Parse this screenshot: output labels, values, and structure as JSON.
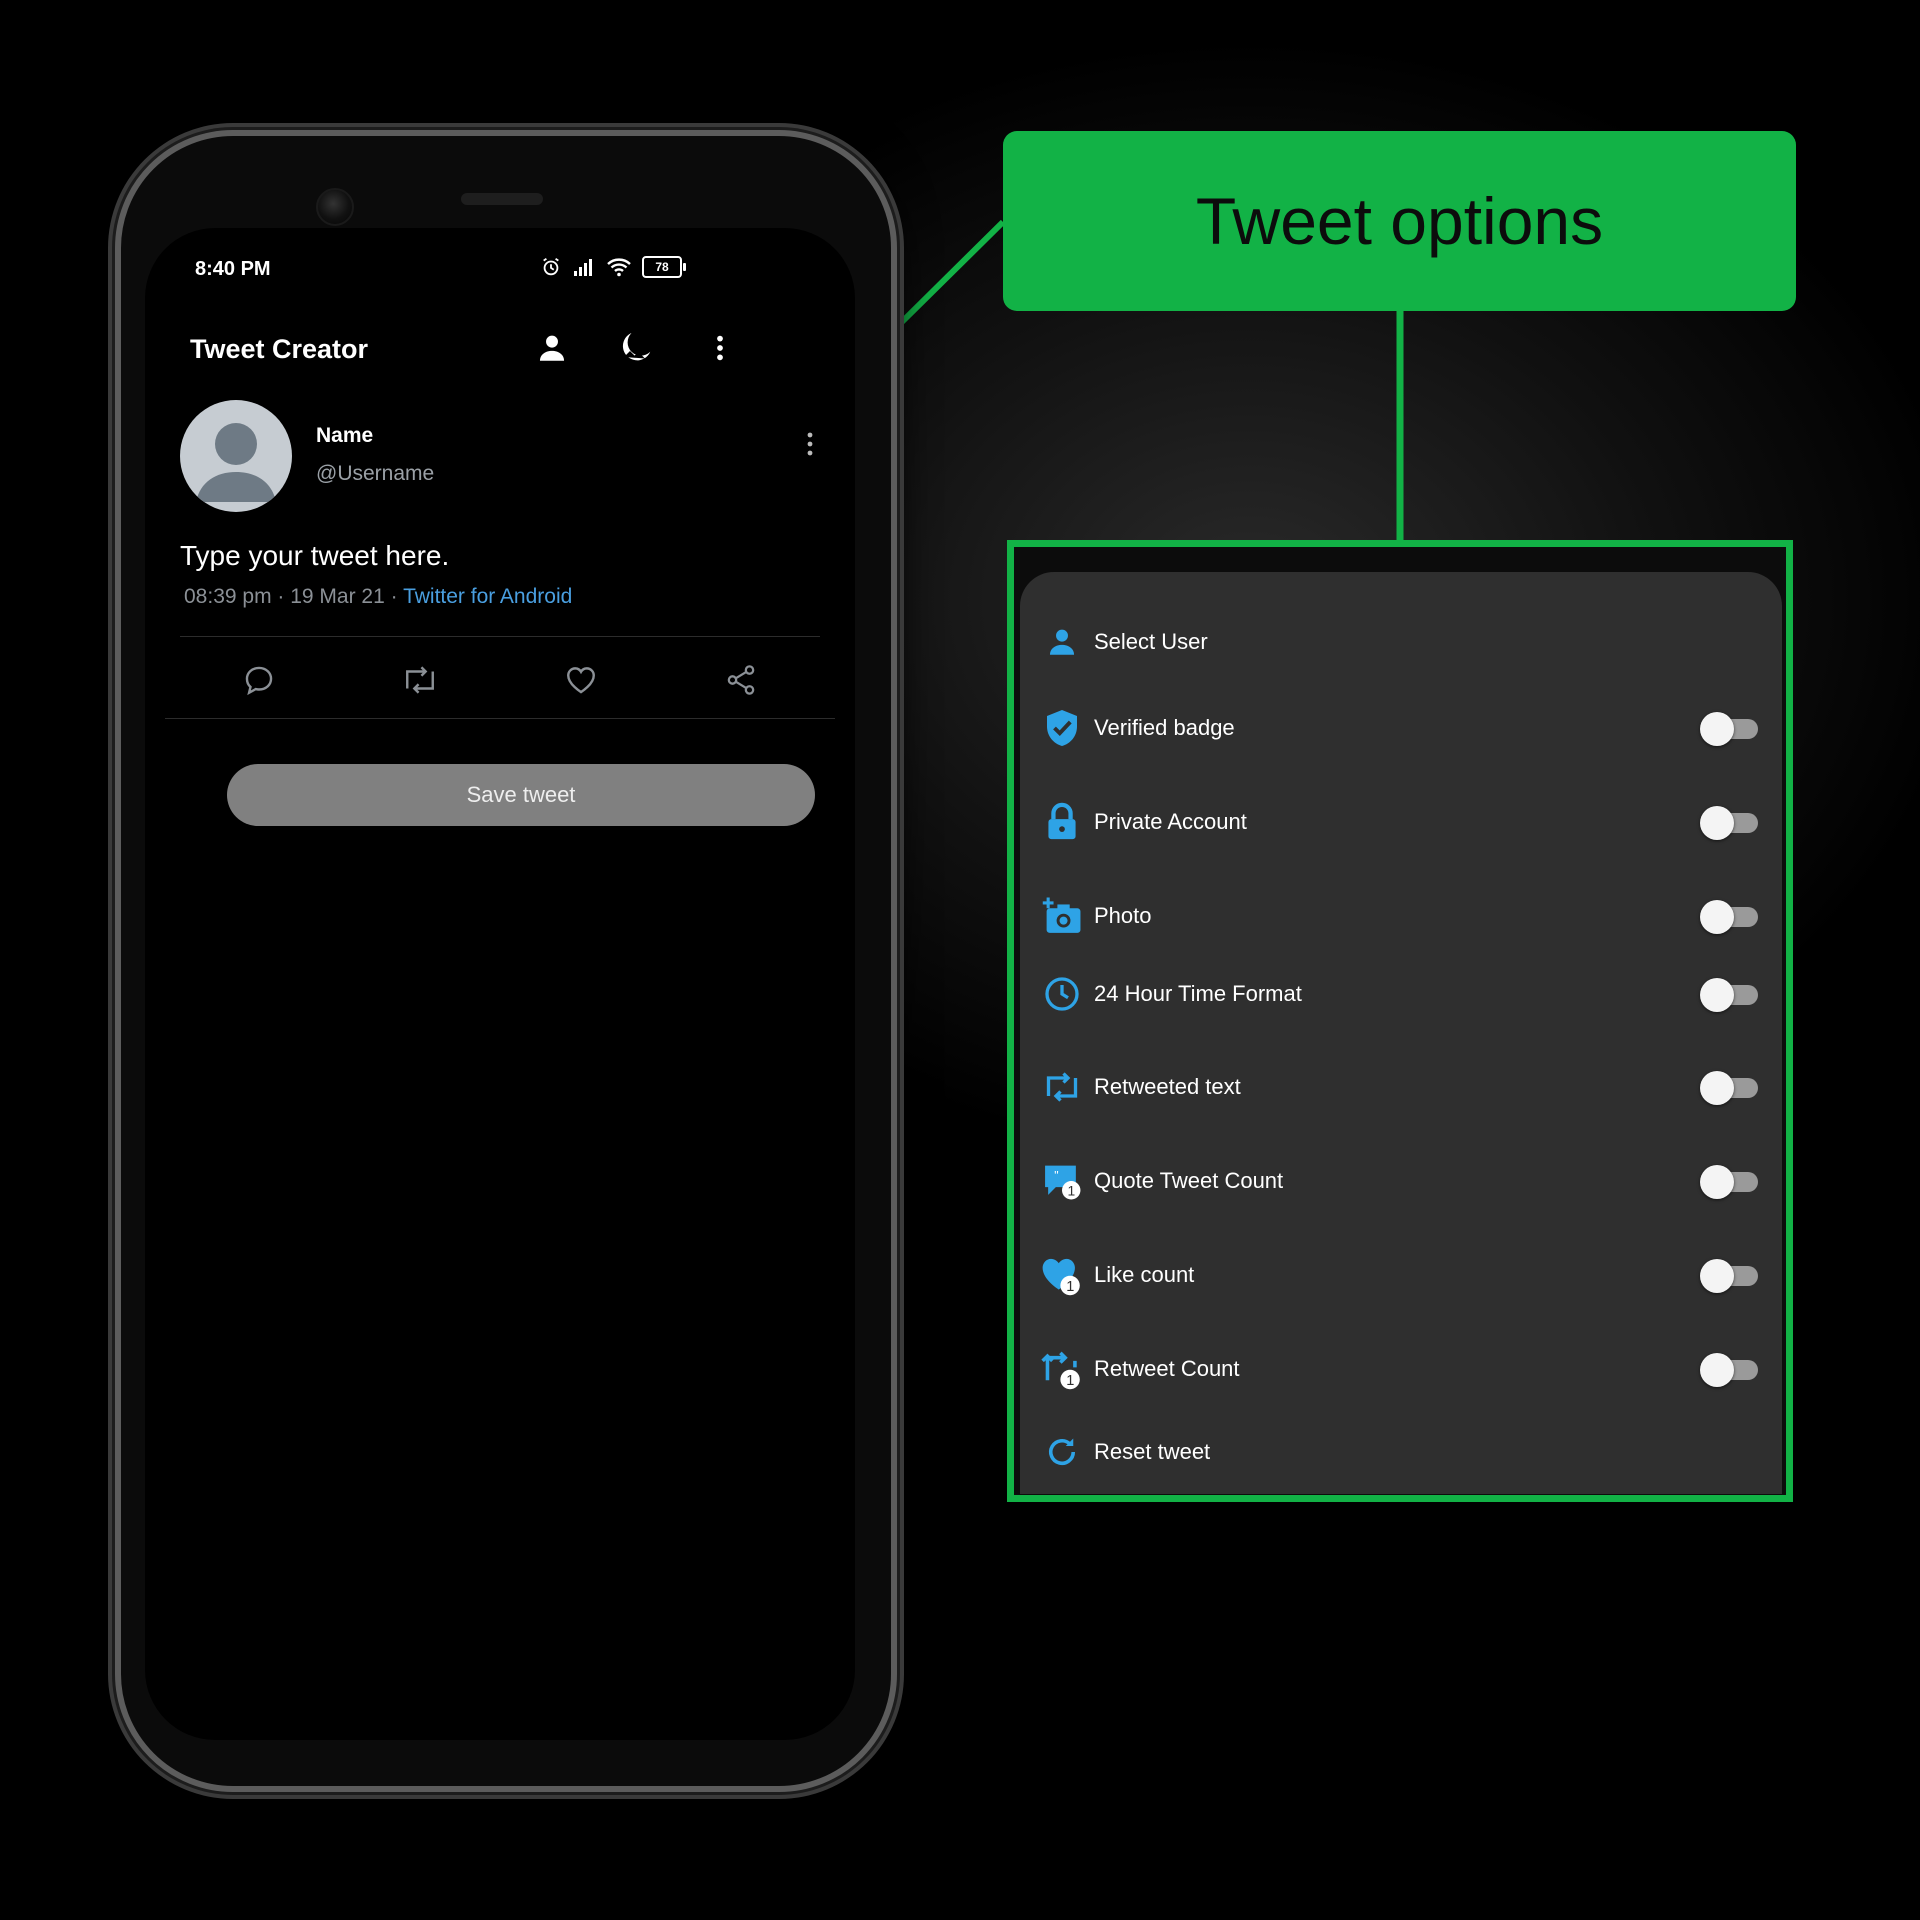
{
  "status_bar": {
    "time": "8:40 PM",
    "battery": "78"
  },
  "app_bar": {
    "title": "Tweet Creator",
    "icons": [
      "person-icon",
      "night-mode-icon",
      "more-vert-icon"
    ]
  },
  "tweet": {
    "name": "Name",
    "handle": "@Username",
    "text": "Type your tweet here.",
    "time_date": "08:39 pm · 19 Mar 21 · ",
    "client": "Twitter for Android",
    "actions": [
      "reply-icon",
      "retweet-icon",
      "like-icon",
      "share-icon"
    ]
  },
  "save_button": "Save tweet",
  "callout": {
    "title": "Tweet options"
  },
  "options": [
    {
      "label": "Select User",
      "icon": "person-icon",
      "has_toggle": false
    },
    {
      "label": "Verified badge",
      "icon": "verified-shield-icon",
      "has_toggle": true,
      "on": false
    },
    {
      "label": "Private Account",
      "icon": "lock-icon",
      "has_toggle": true,
      "on": false
    },
    {
      "label": "Photo",
      "icon": "add-photo-icon",
      "has_toggle": true,
      "on": false
    },
    {
      "label": "24 Hour Time Format",
      "icon": "clock-icon",
      "has_toggle": true,
      "on": false
    },
    {
      "label": "Retweeted text",
      "icon": "retweet-icon",
      "has_toggle": true,
      "on": false
    },
    {
      "label": "Quote Tweet Count",
      "icon": "quote-count-icon",
      "has_toggle": true,
      "on": false
    },
    {
      "label": "Like count",
      "icon": "like-count-icon",
      "has_toggle": true,
      "on": false
    },
    {
      "label": "Retweet Count",
      "icon": "retweet-count-icon",
      "has_toggle": true,
      "on": false
    },
    {
      "label": "Reset tweet",
      "icon": "reset-icon",
      "has_toggle": false
    }
  ],
  "colors": {
    "accent_green": "#12b246",
    "icon_blue": "#2ea3e6",
    "link_blue": "#4a9fe0"
  }
}
